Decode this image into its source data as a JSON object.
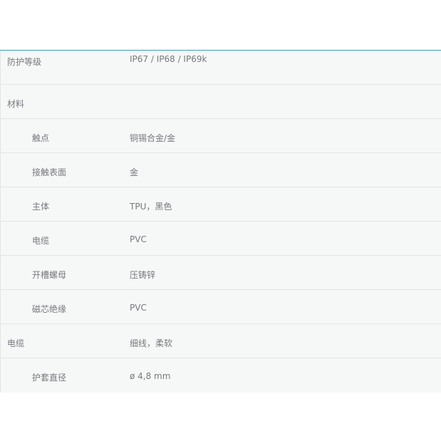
{
  "specs": [
    {
      "label": "防护等级",
      "value": "IP67 / IP68 / IP69k",
      "indent": false
    },
    {
      "label": "材料",
      "value": "",
      "indent": false
    },
    {
      "label": "触点",
      "value": "铜锡合金/金",
      "indent": true
    },
    {
      "label": "接触表面",
      "value": "金",
      "indent": true
    },
    {
      "label": "主体",
      "value": "TPU，黑色",
      "indent": true
    },
    {
      "label": "电缆",
      "value": "PVC",
      "indent": true
    },
    {
      "label": "开槽螺母",
      "value": "压铸锌",
      "indent": true
    },
    {
      "label": "磁芯绝缘",
      "value": "PVC",
      "indent": true
    },
    {
      "label": "电缆",
      "value": "细线，柔软",
      "indent": false
    },
    {
      "label": "护套直径",
      "value": "ø 4,8 mm",
      "indent": true
    }
  ]
}
